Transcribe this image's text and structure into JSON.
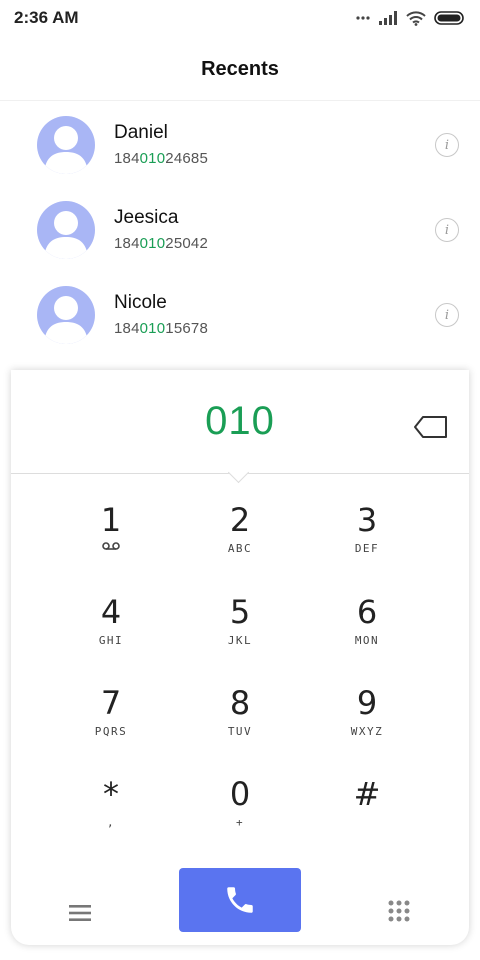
{
  "status_bar": {
    "time": "2:36 AM",
    "icons": [
      "more-dots-icon",
      "signal-icon",
      "wifi-icon",
      "battery-icon"
    ]
  },
  "header": {
    "title": "Recents"
  },
  "recents": [
    {
      "name": "Daniel",
      "number_pre": "184",
      "number_match": "010",
      "number_post": "24685"
    },
    {
      "name": "Jeesica",
      "number_pre": "184",
      "number_match": "010",
      "number_post": "25042"
    },
    {
      "name": "Nicole",
      "number_pre": "184",
      "number_match": "010",
      "number_post": "15678"
    }
  ],
  "dialpad": {
    "dialed": "010",
    "info_glyph": "i",
    "keys": [
      {
        "digit": "1",
        "letters": ""
      },
      {
        "digit": "2",
        "letters": "ABC"
      },
      {
        "digit": "3",
        "letters": "DEF"
      },
      {
        "digit": "4",
        "letters": "GHI"
      },
      {
        "digit": "5",
        "letters": "JKL"
      },
      {
        "digit": "6",
        "letters": "MON"
      },
      {
        "digit": "7",
        "letters": "PQRS"
      },
      {
        "digit": "8",
        "letters": "TUV"
      },
      {
        "digit": "9",
        "letters": "WXYZ"
      },
      {
        "digit": "*",
        "letters": ","
      },
      {
        "digit": "0",
        "letters": "+"
      },
      {
        "digit": "#",
        "letters": ""
      }
    ]
  },
  "colors": {
    "accent_green": "#1a9e55",
    "call_button": "#5a74f0",
    "avatar": "#a9b6f5"
  }
}
